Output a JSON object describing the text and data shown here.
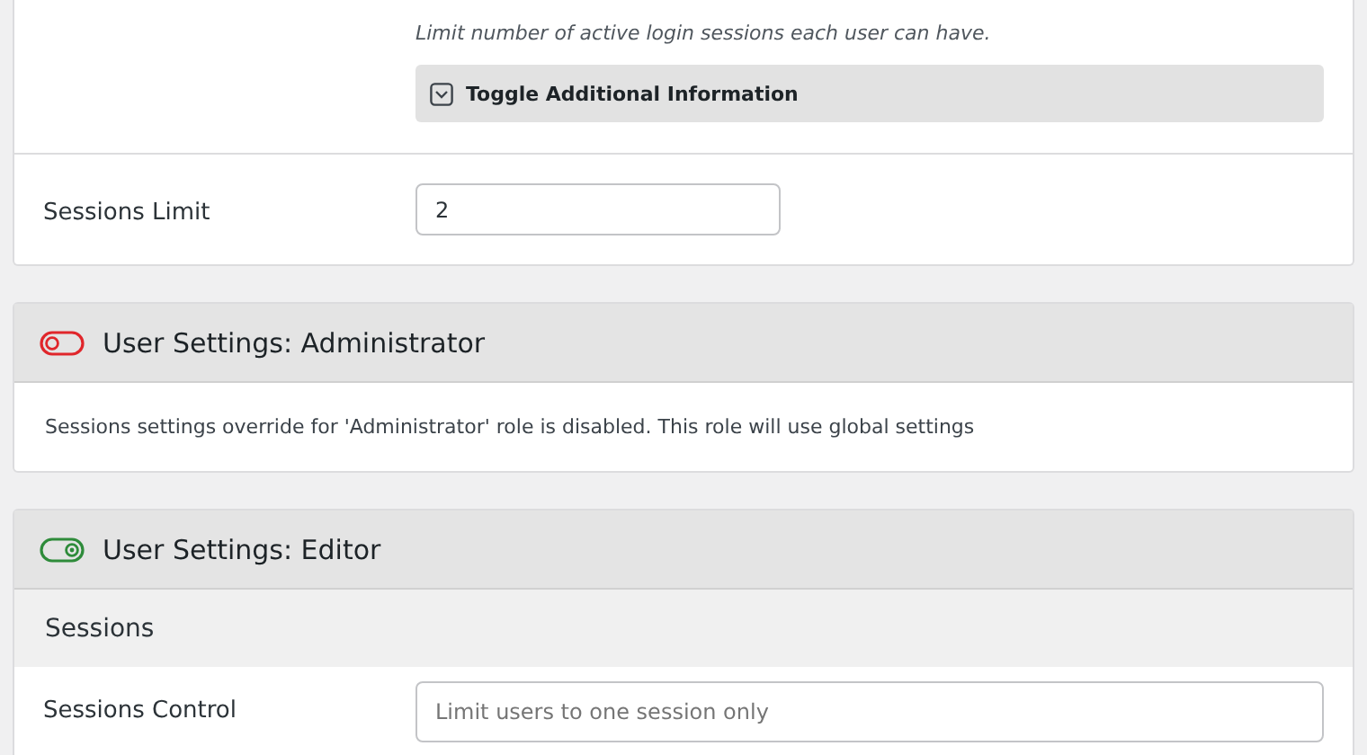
{
  "general_card": {
    "hint": "Limit number of active login sessions each user can have.",
    "toggle_info": {
      "label": "Toggle Additional Information",
      "expanded": false
    },
    "sessions_limit": {
      "label": "Sessions Limit",
      "value": "2"
    }
  },
  "role_cards": [
    {
      "title": "User Settings: Administrator",
      "on": false,
      "message": "Sessions settings override for 'Administrator' role is disabled. This role will use global settings"
    },
    {
      "title": "User Settings: Editor",
      "on": true,
      "section": "Sessions",
      "field": {
        "label": "Sessions Control",
        "placeholder": "Limit users to one session only"
      }
    }
  ]
}
